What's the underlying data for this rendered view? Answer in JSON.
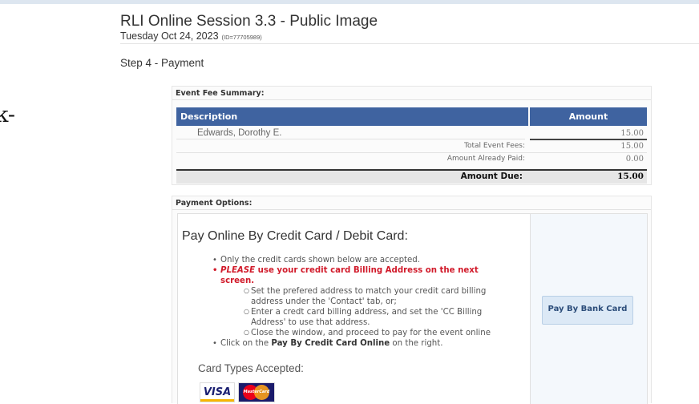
{
  "side_fragment": "k-",
  "header": {
    "title": "RLI Online Session 3.3 - Public Image",
    "date": "Tuesday Oct 24, 2023",
    "id_text": "(ID=77705989)"
  },
  "step": "Step 4 - Payment",
  "fee_summary": {
    "heading": "Event Fee Summary:",
    "col_description": "Description",
    "col_amount": "Amount",
    "attendee_name": "Edwards, Dorothy E.",
    "attendee_amount": "15.00",
    "total_label": "Total Event Fees:",
    "total_value": "15.00",
    "paid_label": "Amount Already Paid:",
    "paid_value": "0.00",
    "due_label": "Amount Due:",
    "due_value": "15.00"
  },
  "payment_options": {
    "heading": "Payment Options:",
    "title": "Pay Online By Credit Card / Debit Card:",
    "bullet1": "Only the credit cards shown below are accepted.",
    "bullet2_em": "PLEASE",
    "bullet2_rest_line1": " use your credit card Billing Address on the next",
    "bullet2_line2": "screen.",
    "sub1_line1": "Set the prefered address to match your credit card billing",
    "sub1_line2": "address under the 'Contact' tab, or;",
    "sub2_line1": "Enter a credt card billing address, and set the 'CC Billing",
    "sub2_line2": "Address' to use that address.",
    "sub3": "Close the window, and proceed to pay for the event online",
    "bullet3_pre": "Click on the ",
    "bullet3_bold": "Pay By Credit Card Online",
    "bullet3_post": " on the right.",
    "card_types_label": "Card Types Accepted:",
    "visa_label": "VISA",
    "mastercard_label": "MasterCard",
    "pay_button": "Pay By Bank Card"
  }
}
